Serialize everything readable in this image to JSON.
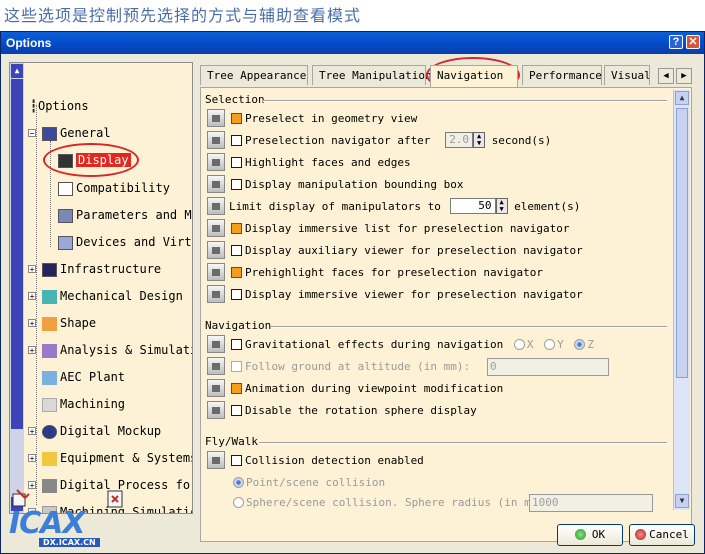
{
  "caption": "这些选项是控制预先选择的方式与辅助查看模式",
  "window": {
    "title": "Options",
    "help_btn": "?",
    "close_btn": "✕"
  },
  "tree": {
    "root": "Options",
    "general": "General",
    "children": [
      "Display",
      "Compatibility",
      "Parameters and Me",
      "Devices and Virtu"
    ],
    "categories": [
      "Infrastructure",
      "Mechanical Design",
      "Shape",
      "Analysis & Simulati",
      "AEC Plant",
      "Machining",
      "Digital Mockup",
      "Equipment & Systems",
      "Digital Process for",
      "Machining Simulatic"
    ]
  },
  "tabs": [
    "Tree Appearance",
    "Tree Manipulation",
    "Navigation",
    "Performance",
    "Visuali"
  ],
  "active_tab": "Navigation",
  "selection": {
    "title": "Selection",
    "preselect": "Preselect in geometry view",
    "preselect_nav_label": "Preselection navigator after",
    "preselect_nav_value": "2.0",
    "preselect_nav_unit": "second(s)",
    "highlight": "Highlight faces and edges",
    "bounding_box": "Display manipulation bounding box",
    "limit_label": "Limit display of manipulators to",
    "limit_value": "50",
    "limit_unit": "element(s)",
    "immersive_list": "Display immersive list for preselection navigator",
    "aux_viewer": "Display auxiliary viewer for preselection navigator",
    "prehighlight": "Prehighlight faces for preselection navigator",
    "immersive_viewer": "Display immersive viewer for preselection navigator"
  },
  "navigation": {
    "title": "Navigation",
    "gravitational": "Gravitational effects during navigation",
    "axis_x": "X",
    "axis_y": "Y",
    "axis_z": "Z",
    "follow_ground": "Follow ground at altitude (in mm):",
    "follow_value": "0",
    "animation": "Animation during viewpoint modification",
    "disable_rotation": "Disable the rotation sphere display"
  },
  "flywalk": {
    "title": "Fly/Walk",
    "collision": "Collision detection enabled",
    "point_scene": "Point/scene collision",
    "sphere_scene": "Sphere/scene collision. Sphere radius (in mm):",
    "sphere_value": "1000"
  },
  "logo": {
    "text": "ICAX",
    "url": "DX.ICAX.CN"
  },
  "buttons": {
    "ok": "OK",
    "cancel": "Cancel"
  },
  "colors": {
    "highlight": "#e0281e",
    "checked": "#f59d1d",
    "title_bar": "#0449c6",
    "panel_bg": "#fdf2d6"
  }
}
